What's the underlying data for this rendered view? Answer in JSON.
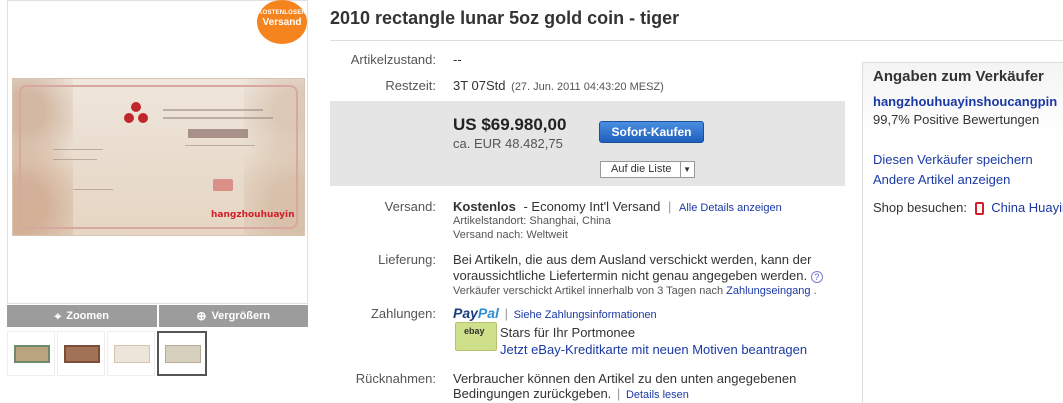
{
  "title": "2010 rectangle lunar 5oz gold coin - tiger",
  "badge": {
    "line1": "KOSTENLOSER",
    "line2": "Versand"
  },
  "image": {
    "watermark": "hangzhouhuayin"
  },
  "image_buttons": {
    "zoom": "Zoomen",
    "enlarge": "Vergrößern"
  },
  "details": {
    "condition_label": "Artikelzustand:",
    "condition_value": "--",
    "time_label": "Restzeit:",
    "time_value": "3T 07Std",
    "time_end": "(27. Jun. 2011 04:43:20 MESZ)"
  },
  "price": {
    "usd": "US $69.980,00",
    "eur": "ca. EUR 48.482,75",
    "buy_button": "Sofort-Kaufen",
    "watch_button": "Auf die Liste"
  },
  "shipping": {
    "label": "Versand:",
    "free": "Kostenlos",
    "method": "- Economy Int'l Versand",
    "sep": "|",
    "details_link": "Alle Details anzeigen",
    "location": "Artikelstandort: Shanghai, China",
    "ships_to": "Versand nach: Weltweit"
  },
  "delivery": {
    "label": "Lieferung:",
    "text1": "Bei Artikeln, die aus dem Ausland verschickt werden, kann der",
    "text2": "voraussichtliche Liefertermin nicht genau angegeben werden.",
    "note": "Verkäufer verschickt Artikel innerhalb von 3 Tagen nach",
    "note_link": "Zahlungseingang",
    "note_end": "."
  },
  "payments": {
    "label": "Zahlungen:",
    "paypal1": "Pay",
    "paypal2": "Pal",
    "sep": "|",
    "info_link": "Siehe Zahlungsinformationen",
    "card_logo": "ebay",
    "promo": "Stars für Ihr Portmonee",
    "promo_link": "Jetzt eBay-Kreditkarte mit neuen Motiven beantragen"
  },
  "returns": {
    "label": "Rücknahmen:",
    "text1": "Verbraucher können den Artikel zu den unten angegebenen",
    "text2": "Bedingungen zurückgeben.",
    "sep": "|",
    "link": "Details lesen"
  },
  "seller": {
    "heading": "Angaben zum Verkäufer",
    "name": "hangzhouhuayinshoucangpin",
    "rating": "99,7% Positive Bewertungen",
    "save": "Diesen Verkäufer speichern",
    "other": "Andere Artikel anzeigen",
    "shop_label": "Shop besuchen:",
    "shop_name": "China Huayin"
  },
  "colors": {
    "accent": "#1a39a4",
    "badge": "#f5841f",
    "buy": "#1f5fbd"
  }
}
